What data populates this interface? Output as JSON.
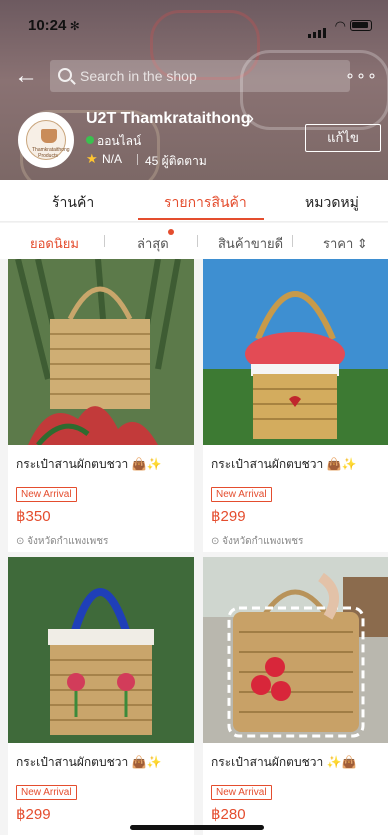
{
  "status": {
    "time": "10:24",
    "time_icon": "gear-small"
  },
  "search": {
    "placeholder": "Search in the shop"
  },
  "shop": {
    "name": "U2T Thamkrataithong",
    "status": "ออนไลน์",
    "rating": "N/A",
    "followers": "45 ผู้ติดตาม",
    "edit_label": "แก้ไข",
    "avatar_text": "Thamkrataithong Products"
  },
  "tabs": [
    {
      "label": "ร้านค้า"
    },
    {
      "label": "รายการสินค้า"
    },
    {
      "label": "หมวดหมู่"
    }
  ],
  "sort": {
    "popular": "ยอดนิยม",
    "latest": "ล่าสุด",
    "best_seller": "สินค้าขายดี",
    "price": "ราคา ⇕"
  },
  "products": [
    {
      "title": "กระเป๋าสานผักตบชวา 👜✨",
      "badge": "New Arrival",
      "price": "฿350",
      "location": "⊙ จังหวัดกำแพงเพชร"
    },
    {
      "title": "กระเป๋าสานผักตบชวา 👜✨",
      "badge": "New Arrival",
      "price": "฿299",
      "location": "⊙ จังหวัดกำแพงเพชร"
    },
    {
      "title": "กระเป๋าสานผักตบชวา 👜✨",
      "badge": "New Arrival",
      "price": "฿299",
      "location": ""
    },
    {
      "title": "กระเป๋าสานผักตบชวา ✨👜",
      "badge": "New Arrival",
      "price": "฿280",
      "location": ""
    }
  ],
  "colors": {
    "accent": "#e44d2e",
    "online": "#3ac14f",
    "star": "#ffc531"
  }
}
